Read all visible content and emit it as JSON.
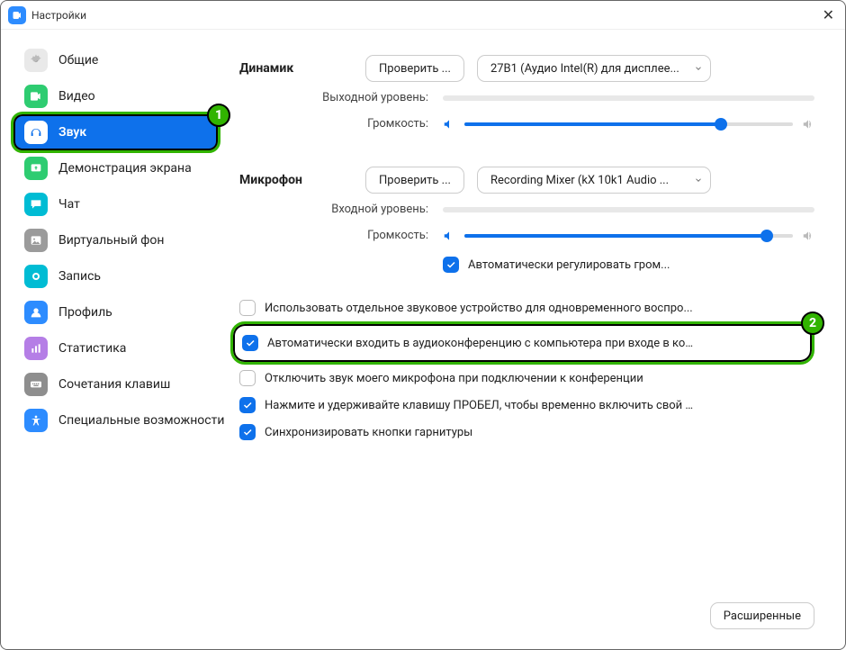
{
  "window": {
    "title": "Настройки"
  },
  "sidebar": {
    "items": [
      {
        "key": "general",
        "label": "Общие",
        "color": "#e9e9e9",
        "icon": "gear"
      },
      {
        "key": "video",
        "label": "Видео",
        "color": "#2ecc71",
        "icon": "video"
      },
      {
        "key": "audio",
        "label": "Звук",
        "color": "#ffffff",
        "icon": "headphones",
        "active": true,
        "highlight": 1
      },
      {
        "key": "share",
        "label": "Демонстрация экрана",
        "color": "#2ecc71",
        "icon": "share"
      },
      {
        "key": "chat",
        "label": "Чат",
        "color": "#00bcd4",
        "icon": "chat"
      },
      {
        "key": "vbg",
        "label": "Виртуальный фон",
        "color": "#9b9b9b",
        "icon": "image"
      },
      {
        "key": "record",
        "label": "Запись",
        "color": "#00bcd4",
        "icon": "record"
      },
      {
        "key": "profile",
        "label": "Профиль",
        "color": "#2D8CFF",
        "icon": "user"
      },
      {
        "key": "stats",
        "label": "Статистика",
        "color": "#b57ee6",
        "icon": "bars"
      },
      {
        "key": "shortcuts",
        "label": "Сочетания клавиш",
        "color": "#8e8e8e",
        "icon": "keyboard"
      },
      {
        "key": "access",
        "label": "Специальные возможности",
        "color": "#2D8CFF",
        "icon": "accessibility"
      }
    ]
  },
  "main": {
    "speaker": {
      "title": "Динамик",
      "test": "Проверить ...",
      "device": "27B1 (Аудио Intel(R) для дисплее...",
      "output_level_label": "Выходной уровень:",
      "volume_label": "Громкость:",
      "volume": 78
    },
    "mic": {
      "title": "Микрофон",
      "test": "Проверить ...",
      "device": "Recording Mixer (kX 10k1 Audio ...",
      "input_level_label": "Входной уровень:",
      "volume_label": "Громкость:",
      "volume": 92,
      "auto_label": "Автоматически регулировать гром...",
      "auto_on": true
    },
    "checks": [
      {
        "on": false,
        "label": "Использовать отдельное звуковое устройство для одновременного воспро..."
      },
      {
        "on": true,
        "label": "Автоматически входить в аудиоконференцию с компьютера при входе в кон...",
        "highlight": 2
      },
      {
        "on": false,
        "label": "Отключить звук моего микрофона при подключении к конференции"
      },
      {
        "on": true,
        "label": "Нажмите и удерживайте клавишу ПРОБЕЛ, чтобы временно включить свой з..."
      },
      {
        "on": true,
        "label": "Синхронизировать кнопки гарнитуры"
      }
    ],
    "advanced": "Расширенные"
  }
}
